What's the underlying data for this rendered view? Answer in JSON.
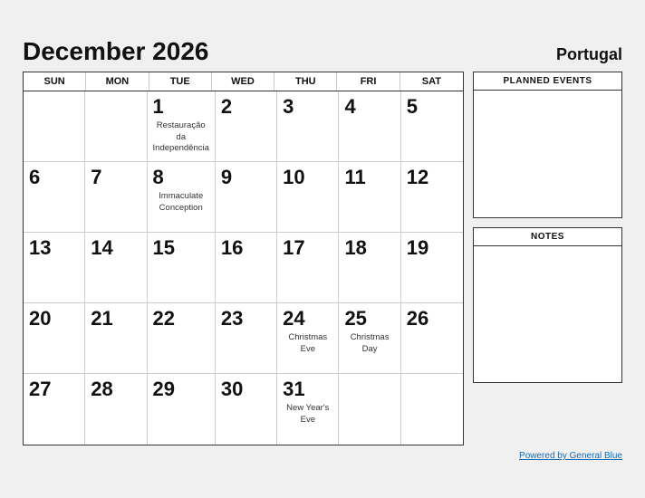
{
  "header": {
    "title": "December 2026",
    "country": "Portugal"
  },
  "dayHeaders": [
    "SUN",
    "MON",
    "TUE",
    "WED",
    "THU",
    "FRI",
    "SAT"
  ],
  "weeks": [
    [
      {
        "num": "",
        "empty": true
      },
      {
        "num": "",
        "empty": true
      },
      {
        "num": "1",
        "event": "Restauração\nda\nIndependência"
      },
      {
        "num": "2",
        "event": ""
      },
      {
        "num": "3",
        "event": ""
      },
      {
        "num": "4",
        "event": ""
      },
      {
        "num": "5",
        "event": ""
      }
    ],
    [
      {
        "num": "6",
        "event": ""
      },
      {
        "num": "7",
        "event": ""
      },
      {
        "num": "8",
        "event": "Immaculate\nConception"
      },
      {
        "num": "9",
        "event": ""
      },
      {
        "num": "10",
        "event": ""
      },
      {
        "num": "11",
        "event": ""
      },
      {
        "num": "12",
        "event": ""
      }
    ],
    [
      {
        "num": "13",
        "event": ""
      },
      {
        "num": "14",
        "event": ""
      },
      {
        "num": "15",
        "event": ""
      },
      {
        "num": "16",
        "event": ""
      },
      {
        "num": "17",
        "event": ""
      },
      {
        "num": "18",
        "event": ""
      },
      {
        "num": "19",
        "event": ""
      }
    ],
    [
      {
        "num": "20",
        "event": ""
      },
      {
        "num": "21",
        "event": ""
      },
      {
        "num": "22",
        "event": ""
      },
      {
        "num": "23",
        "event": ""
      },
      {
        "num": "24",
        "event": "Christmas Eve"
      },
      {
        "num": "25",
        "event": "Christmas Day"
      },
      {
        "num": "26",
        "event": ""
      }
    ],
    [
      {
        "num": "27",
        "event": ""
      },
      {
        "num": "28",
        "event": ""
      },
      {
        "num": "29",
        "event": ""
      },
      {
        "num": "30",
        "event": ""
      },
      {
        "num": "31",
        "event": "New Year's\nEve"
      },
      {
        "num": "",
        "empty": true
      },
      {
        "num": "",
        "empty": true
      }
    ]
  ],
  "sidebar": {
    "planned_events_label": "PLANNED EVENTS",
    "notes_label": "NOTES"
  },
  "footer": {
    "link_text": "Powered by General Blue"
  }
}
